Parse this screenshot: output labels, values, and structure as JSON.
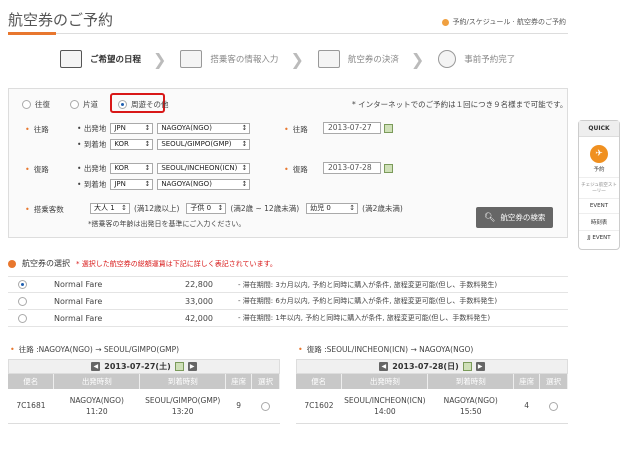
{
  "page": {
    "title": "航空券のご予約"
  },
  "breadcrumb": {
    "text": "予約/スケジュール · 航空券のご予約"
  },
  "steps": [
    {
      "label": "ご希望の日程"
    },
    {
      "label": "搭乗客の情報入力"
    },
    {
      "label": "航空券の決済"
    },
    {
      "label": "事前予約完了"
    }
  ],
  "trip_type": {
    "options": [
      "往復",
      "片道",
      "周遊その他"
    ],
    "selected": "周遊その他",
    "notice": "* インターネットでのご予約は１回につき９名様まで可能です。"
  },
  "outbound": {
    "label": "往路",
    "from_label": "出発地",
    "from_country": "JPN",
    "from_city": "NAGOYA(NGO)",
    "to_label": "到着地",
    "to_country": "KOR",
    "to_city": "SEOUL/GIMPO(GMP)",
    "date_label": "往路",
    "date": "2013-07-27"
  },
  "return": {
    "label": "復路",
    "from_label": "出発地",
    "from_country": "KOR",
    "from_city": "SEOUL/INCHEON(ICN)",
    "to_label": "到着地",
    "to_country": "JPN",
    "to_city": "NAGOYA(NGO)",
    "date_label": "復路",
    "date": "2013-07-28"
  },
  "passengers": {
    "label": "搭乗客数",
    "adult": "大人 1",
    "adult_note": "(満12歳以上)",
    "child": "子供 0",
    "child_note": "(満2歳 ~ 12歳未満)",
    "infant": "幼児 0",
    "infant_note": "(満2歳未満)",
    "age_note": "*搭乗客の年齢は出発日を基準にご入力ください。"
  },
  "search_button": {
    "label": "航空券の検索"
  },
  "quick_menu": {
    "title": "QUICK",
    "items": [
      "予約",
      "チェジュ航空スト一リ一",
      "EVENT",
      "時刻表",
      "JJ EVENT"
    ]
  },
  "fare_section": {
    "title": "航空券の選択",
    "notice": "* 選択した航空券の総額運賃は下記に詳しく表記されています。",
    "fares": [
      {
        "name": "Normal Fare",
        "price": "22,800",
        "desc": "- 滞在期間: 3カ月以内, 予約と同時に購入が条件, 旅程変更可能(但し、手数料発生)"
      },
      {
        "name": "Normal Fare",
        "price": "33,000",
        "desc": "- 滞在期間: 6カ月以内, 予約と同時に購入が条件, 旅程変更可能(但し、手数料発生)"
      },
      {
        "name": "Normal Fare",
        "price": "42,000",
        "desc": "- 滞在期間: 1年以内, 予約と同時に購入が条件, 旅程変更可能(但し、手数料発生)"
      }
    ]
  },
  "outbound_flights": {
    "route": "往路 :NAGOYA(NGO) → SEOUL/GIMPO(GMP)",
    "date": "2013-07-27(土)",
    "headers": [
      "便名",
      "出発時刻",
      "到着時刻",
      "座席",
      "選択"
    ],
    "rows": [
      {
        "flight": "7C1681",
        "dep_place": "NAGOYA(NGO)",
        "dep_time": "11:20",
        "arr_place": "SEOUL/GIMPO(GMP)",
        "arr_time": "13:20",
        "seats": "9"
      }
    ]
  },
  "return_flights": {
    "route": "復路 :SEOUL/INCHEON(ICN) → NAGOYA(NGO)",
    "date": "2013-07-28(日)",
    "headers": [
      "便名",
      "出発時刻",
      "到着時刻",
      "座席",
      "選択"
    ],
    "rows": [
      {
        "flight": "7C1602",
        "dep_place": "SEOUL/INCHEON(ICN)",
        "dep_time": "14:00",
        "arr_place": "NAGOYA(NGO)",
        "arr_time": "15:50",
        "seats": "4"
      }
    ]
  },
  "colors": {
    "accent": "#e8772e",
    "highlight": "#d81818",
    "radio_on": "#1f5fb0"
  }
}
